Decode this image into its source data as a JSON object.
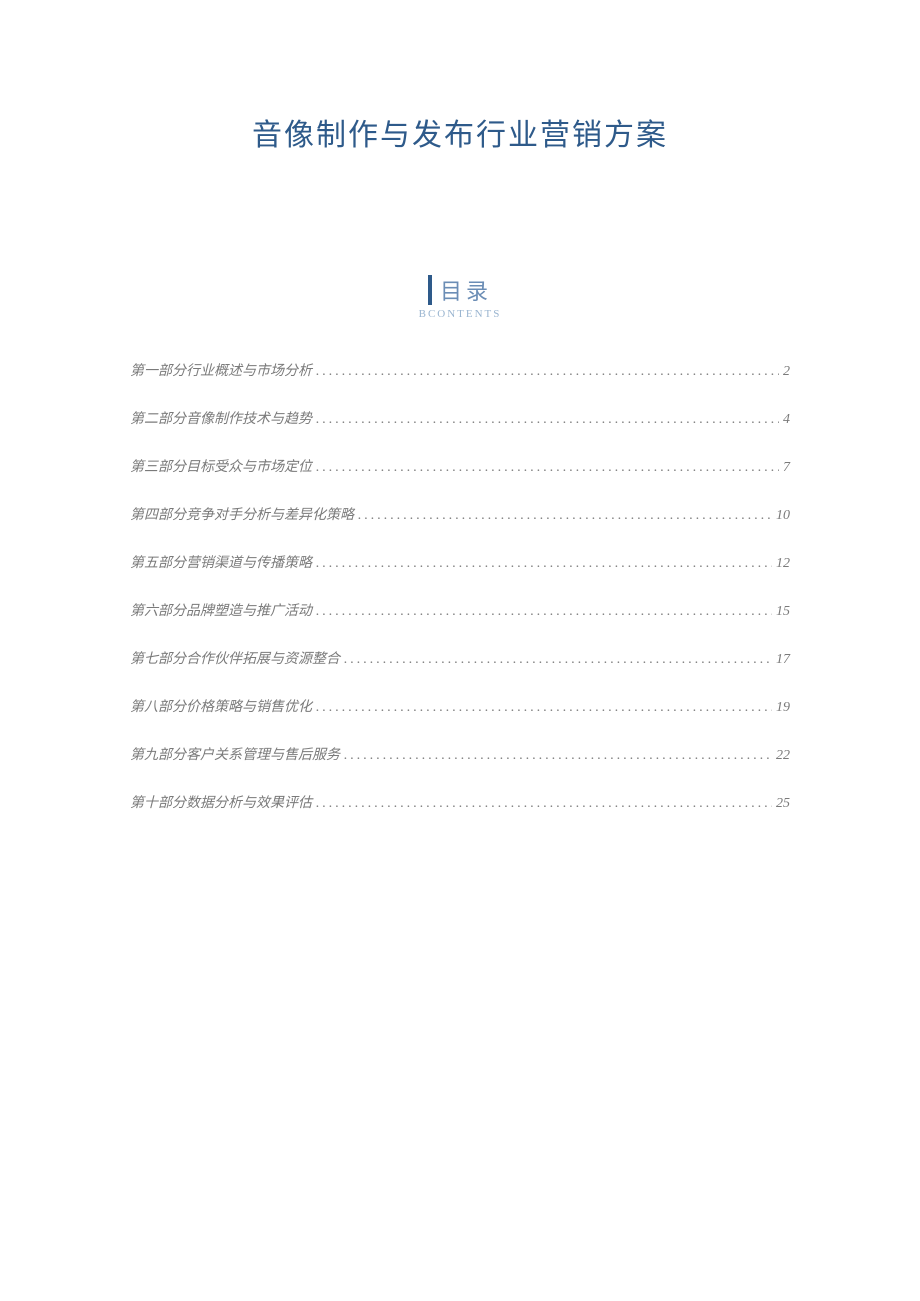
{
  "document": {
    "title": "音像制作与发布行业营销方案"
  },
  "toc": {
    "heading": "目录",
    "subheading": "BCONTENTS",
    "entries": [
      {
        "label": "第一部分行业概述与市场分析",
        "page": "2"
      },
      {
        "label": "第二部分音像制作技术与趋势",
        "page": "4"
      },
      {
        "label": "第三部分目标受众与市场定位",
        "page": "7"
      },
      {
        "label": "第四部分竞争对手分析与差异化策略",
        "page": "10"
      },
      {
        "label": "第五部分营销渠道与传播策略",
        "page": "12"
      },
      {
        "label": "第六部分品牌塑造与推广活动",
        "page": "15"
      },
      {
        "label": "第七部分合作伙伴拓展与资源整合",
        "page": "17"
      },
      {
        "label": "第八部分价格策略与销售优化",
        "page": "19"
      },
      {
        "label": "第九部分客户关系管理与售后服务",
        "page": "22"
      },
      {
        "label": "第十部分数据分析与效果评估",
        "page": "25"
      }
    ]
  }
}
